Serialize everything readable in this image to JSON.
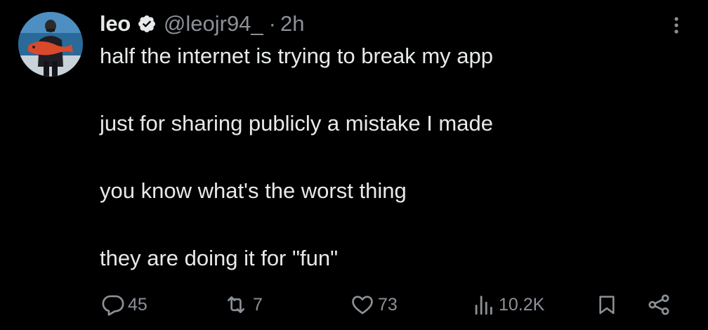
{
  "author": {
    "name": "leo",
    "handle": "@leojr94_",
    "separator": "·",
    "time": "2h"
  },
  "tweet": {
    "lines": [
      "half the internet is trying to break my app",
      "just for sharing publicly a mistake I made",
      "you know what's the worst thing",
      "they are doing it for \"fun\""
    ]
  },
  "actions": {
    "replies": "45",
    "reposts": "7",
    "likes": "73",
    "views": "10.2K"
  },
  "icons": {
    "verified": "verified-badge-icon",
    "more": "more-options-icon",
    "reply": "reply-icon",
    "repost": "repost-icon",
    "like": "heart-icon",
    "views": "views-icon",
    "bookmark": "bookmark-icon",
    "share": "share-icon"
  },
  "colors": {
    "background": "#000000",
    "primary_text": "#e7e9ea",
    "secondary_text": "#8b9197"
  }
}
